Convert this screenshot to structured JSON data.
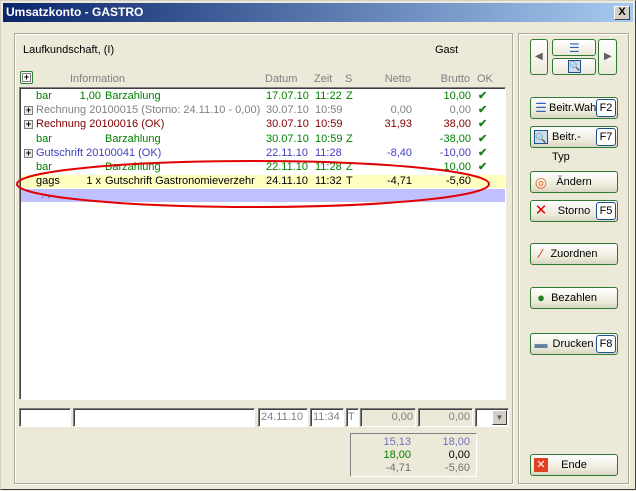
{
  "window": {
    "title": "Umsatzkonto - GASTRO",
    "close_label": "X"
  },
  "customer": {
    "name": "Laufkundschaft, (I)",
    "type": "Gast"
  },
  "columns": {
    "information": "Information",
    "datum": "Datum",
    "zeit": "Zeit",
    "s": "S",
    "netto": "Netto",
    "brutto": "Brutto",
    "ok": "OK"
  },
  "rows": [
    {
      "c1": "bar",
      "qty": "1,00",
      "info": "Barzahlung",
      "datum": "17.07.10",
      "zeit": "11:22",
      "s": "Z",
      "netto": "",
      "brutto": "10,00",
      "ok": "✔",
      "color": "#008000",
      "expand": false
    },
    {
      "c1": "",
      "qty": "",
      "info": "Rechnung 20100015 (Storno: 24.11.10 - 0,00)",
      "datum": "30.07.10",
      "zeit": "10:59",
      "s": "",
      "netto": "0,00",
      "brutto": "0,00",
      "ok": "✔",
      "color": "#808080",
      "expand": true
    },
    {
      "c1": "",
      "qty": "",
      "info": "Rechnung 20100016 (OK)",
      "datum": "30.07.10",
      "zeit": "10:59",
      "s": "",
      "netto": "31,93",
      "brutto": "38,00",
      "ok": "✔",
      "color": "#800000",
      "expand": true
    },
    {
      "c1": "bar",
      "qty": "",
      "info": "Barzahlung",
      "datum": "30.07.10",
      "zeit": "10:59",
      "s": "Z",
      "netto": "",
      "brutto": "-38,00",
      "ok": "✔",
      "color": "#008000",
      "expand": false
    },
    {
      "c1": "",
      "qty": "",
      "info": "Gutschrift 20100041 (OK)",
      "datum": "22.11.10",
      "zeit": "11:28",
      "s": "",
      "netto": "-8,40",
      "brutto": "-10,00",
      "ok": "✔",
      "color": "#4040c0",
      "expand": true
    },
    {
      "c1": "bar",
      "qty": "",
      "info": "Barzahlung",
      "datum": "22.11.10",
      "zeit": "11:28",
      "s": "Z",
      "netto": "",
      "brutto": "10,00",
      "ok": "✔",
      "color": "#008000",
      "expand": false
    },
    {
      "c1": "gags",
      "qty": "1 x",
      "info": "Gutschrift Gastronomieverzehr",
      "datum": "24.11.10",
      "zeit": "11:32",
      "s": "T",
      "netto": "-4,71",
      "brutto": "-5,60",
      "ok": "",
      "color": "#000000",
      "expand": false
    }
  ],
  "new_row": {
    "dots": ". ."
  },
  "entry": {
    "field1": "",
    "field2": "",
    "datum": "24.11.10",
    "zeit": "11:34",
    "s": "T",
    "netto": "0,00",
    "brutto": "0,00"
  },
  "totals": {
    "netto_1": "15,13",
    "brutto_1": "18,00",
    "netto_2": "18,00",
    "brutto_2": "0,00",
    "netto_3": "-4,71",
    "brutto_3": "-5,60"
  },
  "buttons": {
    "beitr_wahl": "Beitr.Wah",
    "beitr_wahl_key": "F2",
    "beitr_typ": "Beitr.-Typ",
    "beitr_typ_key": "F7",
    "aendern": "Ändern",
    "storno": "Storno",
    "storno_key": "F5",
    "zuordnen": "Zuordnen",
    "bezahlen": "Bezahlen",
    "drucken": "Drucken",
    "drucken_key": "F8",
    "ende": "Ende"
  },
  "colors": {
    "highlight_row": "#ffffc0",
    "selected_row": "#c0c0ff",
    "annotation": "#e00000"
  }
}
